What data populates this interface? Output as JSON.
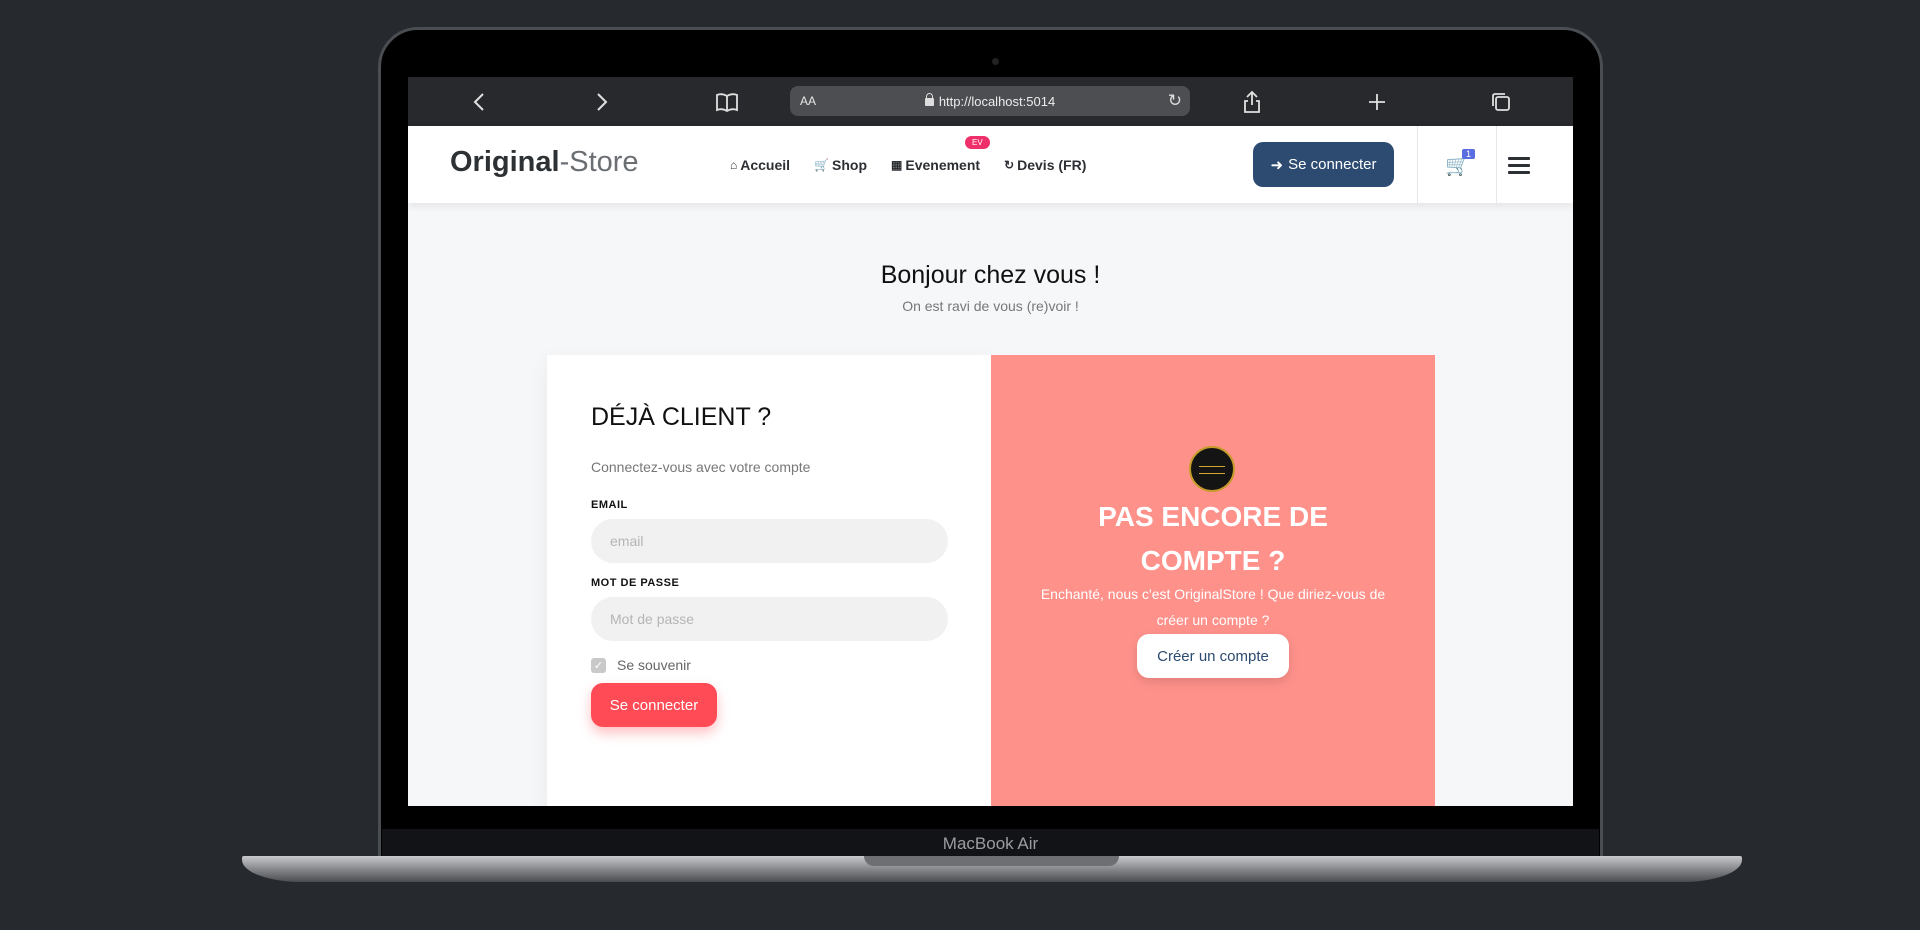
{
  "device": {
    "label": "MacBook Air"
  },
  "browser": {
    "text_size_label": "AA",
    "url": "http://localhost:5014",
    "icons": [
      "back-icon",
      "forward-icon",
      "bookmarks-icon",
      "lock-icon",
      "reload-icon",
      "share-icon",
      "new-tab-icon",
      "tabs-icon"
    ]
  },
  "nav": {
    "brand_strong": "Original",
    "brand_light": "-Store",
    "items": [
      {
        "label": "Accueil",
        "icon": "home-icon"
      },
      {
        "label": "Shop",
        "icon": "cart-icon"
      },
      {
        "label": "Evenement",
        "icon": "calendar-icon",
        "badge": "EV"
      },
      {
        "label": "Devis (FR)",
        "icon": "refresh-icon"
      }
    ],
    "login_label": "Se connecter",
    "cart_count": "1"
  },
  "hero": {
    "title": "Bonjour chez vous !",
    "subtitle": "On est ravi de vous (re)voir !"
  },
  "login": {
    "title": "DÉJÀ CLIENT ?",
    "subtitle": "Connectez-vous avec votre compte",
    "email_label": "EMAIL",
    "email_placeholder": "email",
    "password_label": "MOT DE PASSE",
    "password_placeholder": "Mot de passe",
    "remember_label": "Se souvenir",
    "remember_checked": true,
    "submit_label": "Se connecter"
  },
  "signup": {
    "title": "PAS ENCORE DE COMPTE ?",
    "subtitle": "Enchanté, nous c'est OriginalStore ! Que diriez-vous de créer un compte ?",
    "button_label": "Créer un compte"
  },
  "colors": {
    "primary_button": "#2d4b70",
    "accent_red": "#ff4b55",
    "signup_panel": "#ff918b",
    "badge": "#ef2f6a",
    "cart_badge": "#5b6ee1"
  }
}
